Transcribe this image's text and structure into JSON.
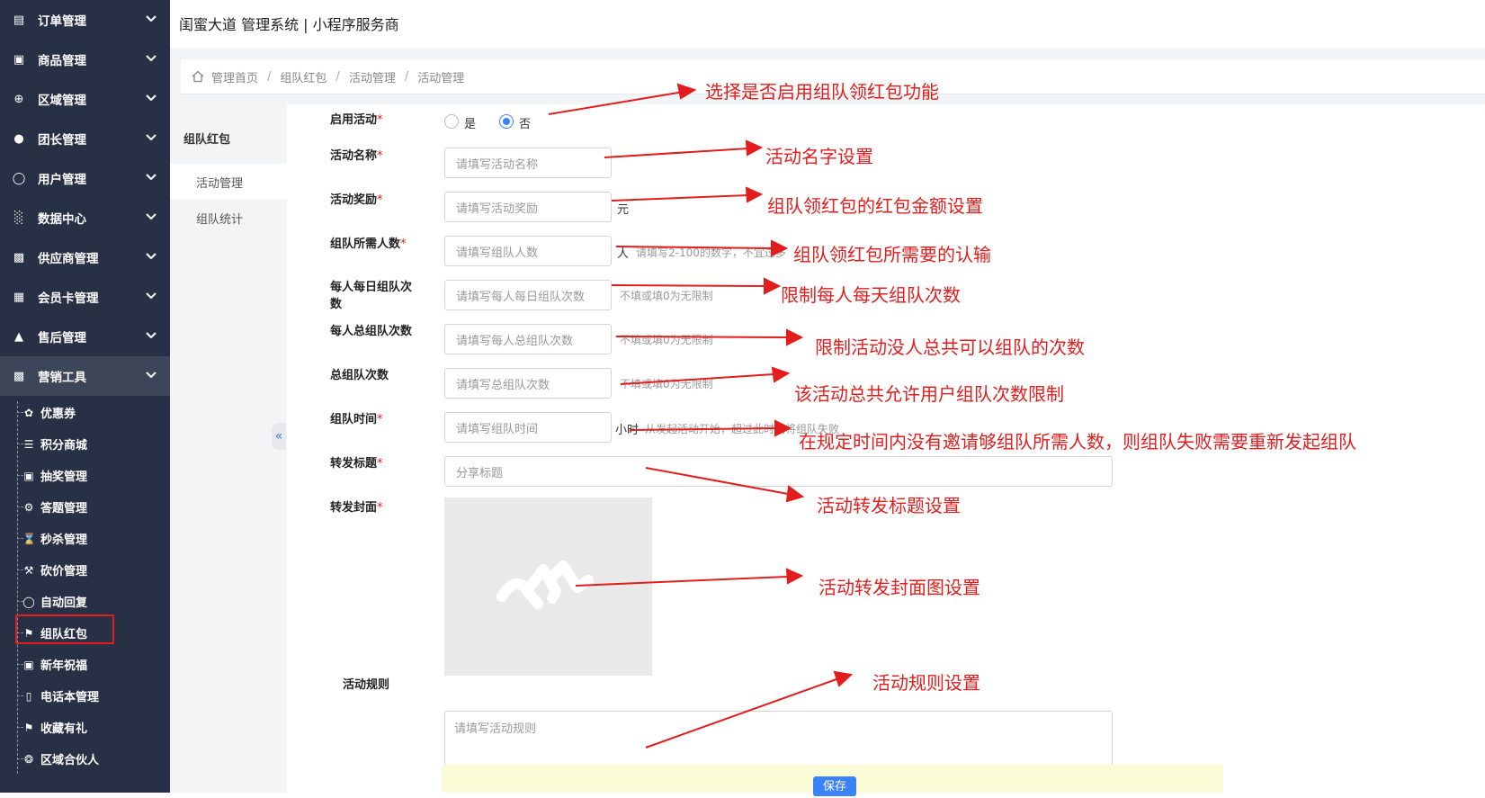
{
  "app": {
    "title": "闺蜜大道 管理系统 | 小程序服务商"
  },
  "sidebar": {
    "items": [
      {
        "label": "订单管理",
        "icon": "list-icon"
      },
      {
        "label": "商品管理",
        "icon": "gift-icon"
      },
      {
        "label": "区域管理",
        "icon": "crosshair-icon"
      },
      {
        "label": "团长管理",
        "icon": "group-icon"
      },
      {
        "label": "用户管理",
        "icon": "user-icon"
      },
      {
        "label": "数据中心",
        "icon": "bar-chart-icon"
      },
      {
        "label": "供应商管理",
        "icon": "briefcase-icon"
      },
      {
        "label": "会员卡管理",
        "icon": "card-icon"
      },
      {
        "label": "售后管理",
        "icon": "shield-icon"
      },
      {
        "label": "营销工具",
        "icon": "briefcase-icon"
      }
    ],
    "marketing_children": [
      {
        "label": "优惠券",
        "icon": "yelp-icon"
      },
      {
        "label": "积分商城",
        "icon": "database-icon"
      },
      {
        "label": "抽奖管理",
        "icon": "gift-icon"
      },
      {
        "label": "答题管理",
        "icon": "gear-icon"
      },
      {
        "label": "秒杀管理",
        "icon": "hourglass-icon"
      },
      {
        "label": "砍价管理",
        "icon": "gavel-icon"
      },
      {
        "label": "自动回复",
        "icon": "user-icon"
      },
      {
        "label": "组队红包",
        "icon": "tags-icon"
      },
      {
        "label": "新年祝福",
        "icon": "gift-icon"
      },
      {
        "label": "电话本管理",
        "icon": "phone-icon"
      },
      {
        "label": "收藏有礼",
        "icon": "tags-icon"
      },
      {
        "label": "区域合伙人",
        "icon": "aperture-icon"
      }
    ]
  },
  "breadcrumb": [
    "管理首页",
    "组队红包",
    "活动管理",
    "活动管理"
  ],
  "subnav": {
    "title": "组队红包",
    "items": [
      "活动管理",
      "组队统计"
    ]
  },
  "form": {
    "enable": {
      "label": "启用活动",
      "options": [
        "是",
        "否"
      ],
      "selected": "否"
    },
    "name": {
      "label": "活动名称",
      "placeholder": "请填写活动名称"
    },
    "reward": {
      "label": "活动奖励",
      "placeholder": "请填写活动奖励",
      "unit": "元"
    },
    "team_size": {
      "label": "组队所需人数",
      "placeholder": "请填写组队人数",
      "unit": "人",
      "help": "请填写2-100的数字，不宜过多"
    },
    "daily_limit": {
      "label_line1": "每人每日组队次",
      "label_line2": "数",
      "placeholder": "请填写每人每日组队次数",
      "help": "不填或填0为无限制"
    },
    "total_per_user": {
      "label": "每人总组队次数",
      "placeholder": "请填写每人总组队次数",
      "help": "不填或填0为无限制"
    },
    "total_limit": {
      "label": "总组队次数",
      "placeholder": "请填写总组队次数",
      "help": "不填或填0为无限制"
    },
    "duration": {
      "label": "组队时间",
      "placeholder": "请填写组队时间",
      "unit": "小时",
      "help": "从发起活动开始，超过此时间将组队失败"
    },
    "share_title": {
      "label": "转发标题",
      "placeholder": "分享标题"
    },
    "share_cover": {
      "label": "转发封面"
    },
    "rules": {
      "label": "活动规则",
      "placeholder": "请填写活动规则"
    },
    "save_label": "保存"
  },
  "annotations": [
    "选择是否启用组队领红包功能",
    "活动名字设置",
    "组队领红包的红包金额设置",
    "组队领红包所需要的认输",
    "限制每人每天组队次数",
    "限制活动没人总共可以组队的次数",
    "该活动总共允许用户组队次数限制",
    "在规定时间内没有邀请够组队所需人数，则组队失败需要重新发起组队",
    "活动转发标题设置",
    "活动转发封面图设置",
    "活动规则设置"
  ],
  "colors": {
    "sidebar_bg": "#283046",
    "accent": "#3b82f6",
    "annotation": "#e31d1d"
  }
}
